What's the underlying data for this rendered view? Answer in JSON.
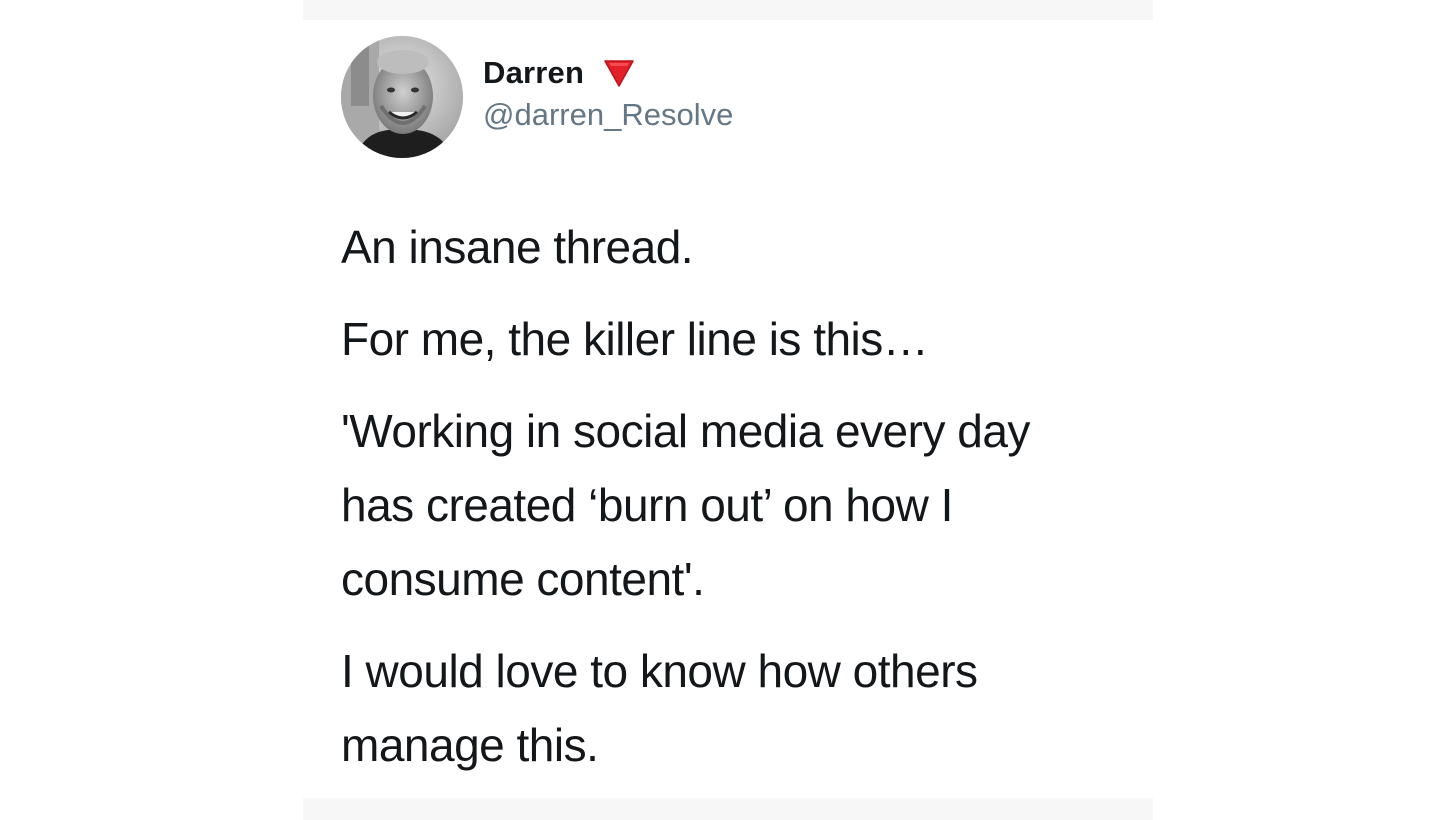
{
  "tweet": {
    "author": {
      "display_name": "Darren",
      "handle": "@darren_Resolve",
      "badge_icon": "red-triangle-down-icon",
      "badge_color": "#e2202a"
    },
    "paragraphs": [
      "An insane thread.",
      "For me, the killer line is this…",
      "'Working in social media every day\nhas created ‘burn out’ on how I\nconsume content'.",
      "I would love to know how others\nmanage this."
    ]
  }
}
